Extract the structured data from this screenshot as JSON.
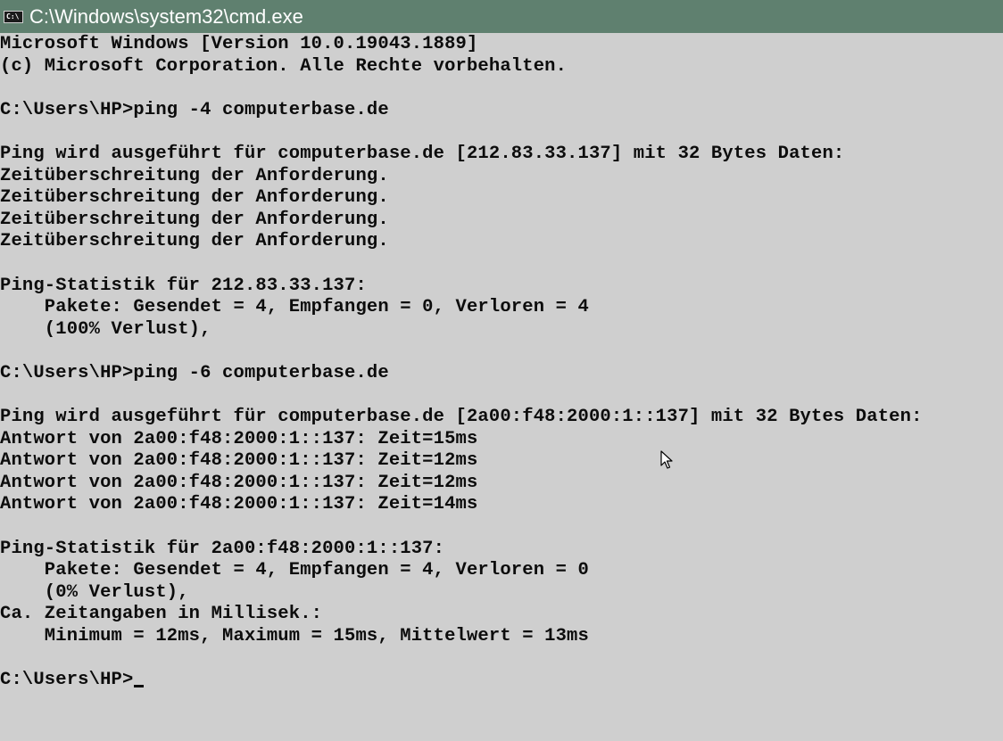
{
  "window": {
    "title": "C:\\Windows\\system32\\cmd.exe",
    "icon": "cmd-icon",
    "icon_glyph": "C:\\"
  },
  "colors": {
    "titlebar_bg": "#5f806f",
    "console_bg": "#cfcfcf",
    "console_text": "#0c0c0c"
  },
  "console": {
    "lines": [
      "Microsoft Windows [Version 10.0.19043.1889]",
      "(c) Microsoft Corporation. Alle Rechte vorbehalten.",
      "",
      "C:\\Users\\HP>ping -4 computerbase.de",
      "",
      "Ping wird ausgeführt für computerbase.de [212.83.33.137] mit 32 Bytes Daten:",
      "Zeitüberschreitung der Anforderung.",
      "Zeitüberschreitung der Anforderung.",
      "Zeitüberschreitung der Anforderung.",
      "Zeitüberschreitung der Anforderung.",
      "",
      "Ping-Statistik für 212.83.33.137:",
      "    Pakete: Gesendet = 4, Empfangen = 0, Verloren = 4",
      "    (100% Verlust),",
      "",
      "C:\\Users\\HP>ping -6 computerbase.de",
      "",
      "Ping wird ausgeführt für computerbase.de [2a00:f48:2000:1::137] mit 32 Bytes Daten:",
      "Antwort von 2a00:f48:2000:1::137: Zeit=15ms",
      "Antwort von 2a00:f48:2000:1::137: Zeit=12ms",
      "Antwort von 2a00:f48:2000:1::137: Zeit=12ms",
      "Antwort von 2a00:f48:2000:1::137: Zeit=14ms",
      "",
      "Ping-Statistik für 2a00:f48:2000:1::137:",
      "    Pakete: Gesendet = 4, Empfangen = 4, Verloren = 0",
      "    (0% Verlust),",
      "Ca. Zeitangaben in Millisek.:",
      "    Minimum = 12ms, Maximum = 15ms, Mittelwert = 13ms",
      ""
    ],
    "prompt": "C:\\Users\\HP>"
  }
}
